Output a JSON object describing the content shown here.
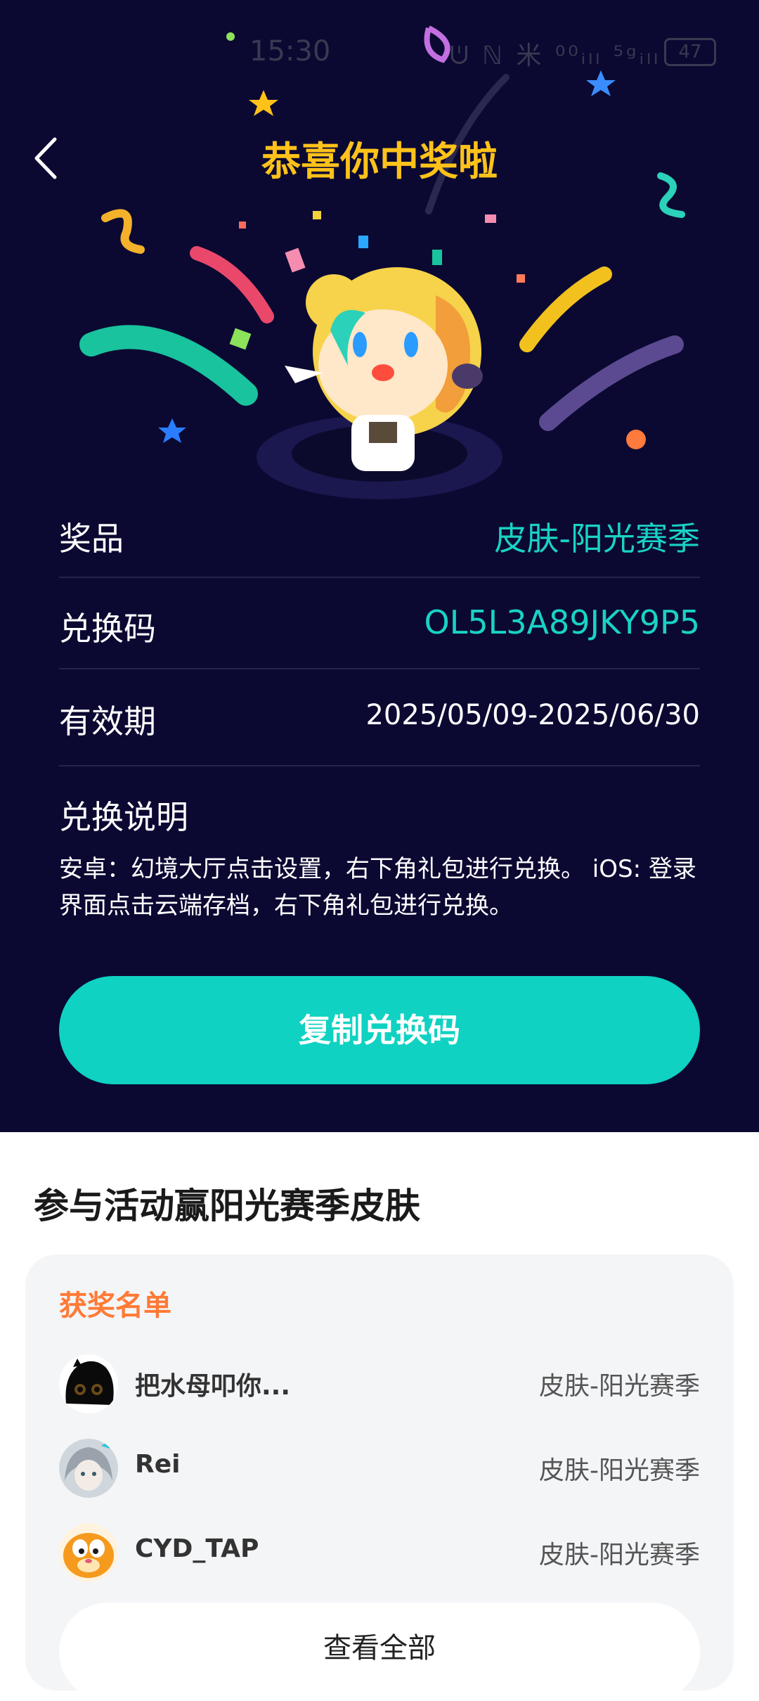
{
  "status_bar": {
    "time": "15:30",
    "icons": "ᕫ ℕ 米 ⁰⁰ᵢₗₗ ⁵ᵍᵢₗₗ",
    "battery": "47"
  },
  "header": {
    "title": "恭喜你中奖啦"
  },
  "prize_info": {
    "prize_label": "奖品",
    "prize_value": "皮肤-阳光赛季",
    "code_label": "兑换码",
    "code_value": "OL5L3A89JKY9P5",
    "validity_label": "有效期",
    "validity_value": "2025/05/09-2025/06/30",
    "instructions_title": "兑换说明",
    "instructions_text": "安卓：幻境大厅点击设置，右下角礼包进行兑换。 iOS: 登录界面点击云端存档，右下角礼包进行兑换。",
    "accent_color": "#19d3c5",
    "copy_button": "复制兑换码"
  },
  "activity": {
    "title": "参与活动赢阳光赛季皮肤",
    "winners_title": "获奖名单",
    "winners": [
      {
        "name": "把水母叩你...",
        "prize": "皮肤-阳光赛季",
        "avatar": "dark-creature-avatar"
      },
      {
        "name": "Rei",
        "prize": "皮肤-阳光赛季",
        "avatar": "anime-girl-avatar"
      },
      {
        "name": "CYD_TAP",
        "prize": "皮肤-阳光赛季",
        "avatar": "garfield-avatar"
      }
    ],
    "view_all": "查看全部"
  }
}
